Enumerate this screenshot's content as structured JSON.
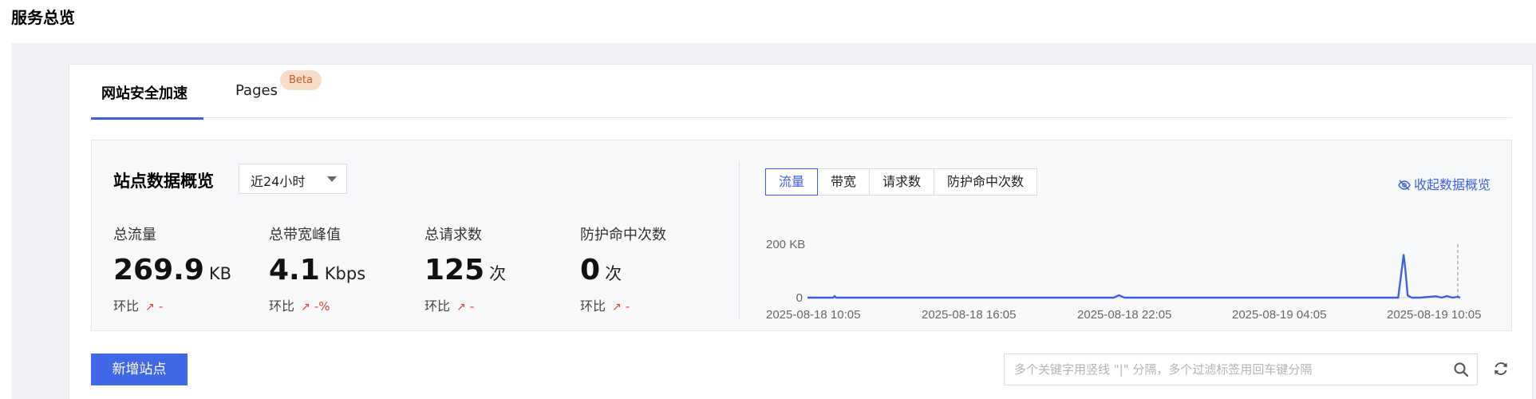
{
  "page": {
    "title": "服务总览"
  },
  "tabs": [
    {
      "label": "网站安全加速",
      "active": true
    },
    {
      "label": "Pages",
      "badge": "Beta",
      "active": false
    }
  ],
  "overview": {
    "title": "站点数据概览",
    "time_range": {
      "selected": "近24小时"
    },
    "stats": [
      {
        "label": "总流量",
        "value": "269.9",
        "unit": "KB",
        "compare_label": "环比",
        "compare_value": "-"
      },
      {
        "label": "总带宽峰值",
        "value": "4.1",
        "unit": "Kbps",
        "compare_label": "环比",
        "compare_value": "-%"
      },
      {
        "label": "总请求数",
        "value": "125",
        "unit": "次",
        "compare_label": "环比",
        "compare_value": "-"
      },
      {
        "label": "防护命中次数",
        "value": "0",
        "unit": "次",
        "compare_label": "环比",
        "compare_value": "-"
      }
    ],
    "metric_tabs": [
      {
        "label": "流量",
        "active": true
      },
      {
        "label": "带宽",
        "active": false
      },
      {
        "label": "请求数",
        "active": false
      },
      {
        "label": "防护命中次数",
        "active": false
      }
    ],
    "collapse_label": "收起数据概览"
  },
  "chart_data": {
    "type": "line",
    "title": "",
    "xlabel": "",
    "ylabel": "",
    "y_ticks": [
      "200 KB",
      "0"
    ],
    "ylim": [
      0,
      200
    ],
    "x_tick_labels": [
      "2025-08-18 10:05",
      "2025-08-18 16:05",
      "2025-08-18 22:05",
      "2025-08-19 04:05",
      "2025-08-19 10:05"
    ],
    "x": [
      0,
      0.5,
      0.95,
      1,
      1.05,
      1.5,
      6,
      6.5,
      11.3,
      11.5,
      11.7,
      12,
      18,
      21.8,
      22,
      22.05,
      22.15,
      22.3,
      22.6,
      23.2,
      23.4,
      23.6,
      23.8,
      24
    ],
    "series": [
      {
        "values": [
          0,
          0,
          0,
          6,
          0,
          0,
          0,
          0,
          0,
          9,
          0,
          0,
          0,
          0,
          160,
          120,
          8,
          0,
          0,
          5,
          0,
          6,
          0,
          3
        ],
        "color": "#3f5fe0"
      }
    ],
    "grid": false
  },
  "actions": {
    "add_site": "新增站点",
    "search_placeholder": "多个关键字用竖线 \"|\" 分隔，多个过滤标签用回车键分隔"
  },
  "colors": {
    "accent": "#3f5fe0",
    "trend": "#d9442d",
    "badge_bg": "#f7dcc7"
  }
}
